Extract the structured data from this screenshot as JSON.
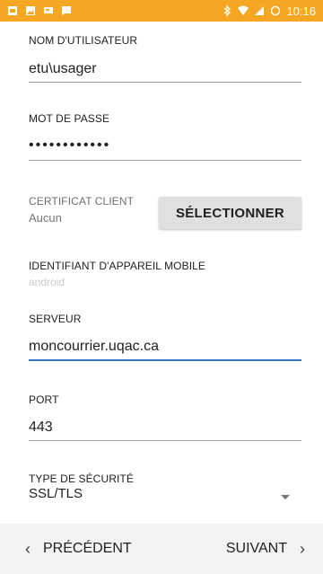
{
  "status_bar": {
    "left_icons": [
      "sim-card-icon",
      "image-icon",
      "chat-icon",
      "message-icon"
    ],
    "right_icons": [
      "bluetooth-icon",
      "wifi-icon",
      "signal-icon",
      "battery-icon"
    ],
    "time": "10:16",
    "color": "#f5a623"
  },
  "form": {
    "username": {
      "label": "NOM D'UTILISATEUR",
      "value": "etu\\usager"
    },
    "password": {
      "label": "MOT DE PASSE",
      "value": "••••••••••••"
    },
    "certificate": {
      "label": "CERTIFICAT CLIENT",
      "value": "Aucun",
      "button": "SÉLECTIONNER"
    },
    "device_id": {
      "label": "IDENTIFIANT D'APPAREIL MOBILE",
      "value": "android"
    },
    "server": {
      "label": "SERVEUR",
      "value": "moncourrier.uqac.ca",
      "focus_color": "#3a75c4"
    },
    "port": {
      "label": "PORT",
      "value": "443"
    },
    "security": {
      "label": "TYPE DE SÉCURITÉ",
      "value": "SSL/TLS"
    }
  },
  "nav": {
    "prev": "PRÉCÉDENT",
    "next": "SUIVANT",
    "prev_icon": "‹",
    "next_icon": "›"
  }
}
